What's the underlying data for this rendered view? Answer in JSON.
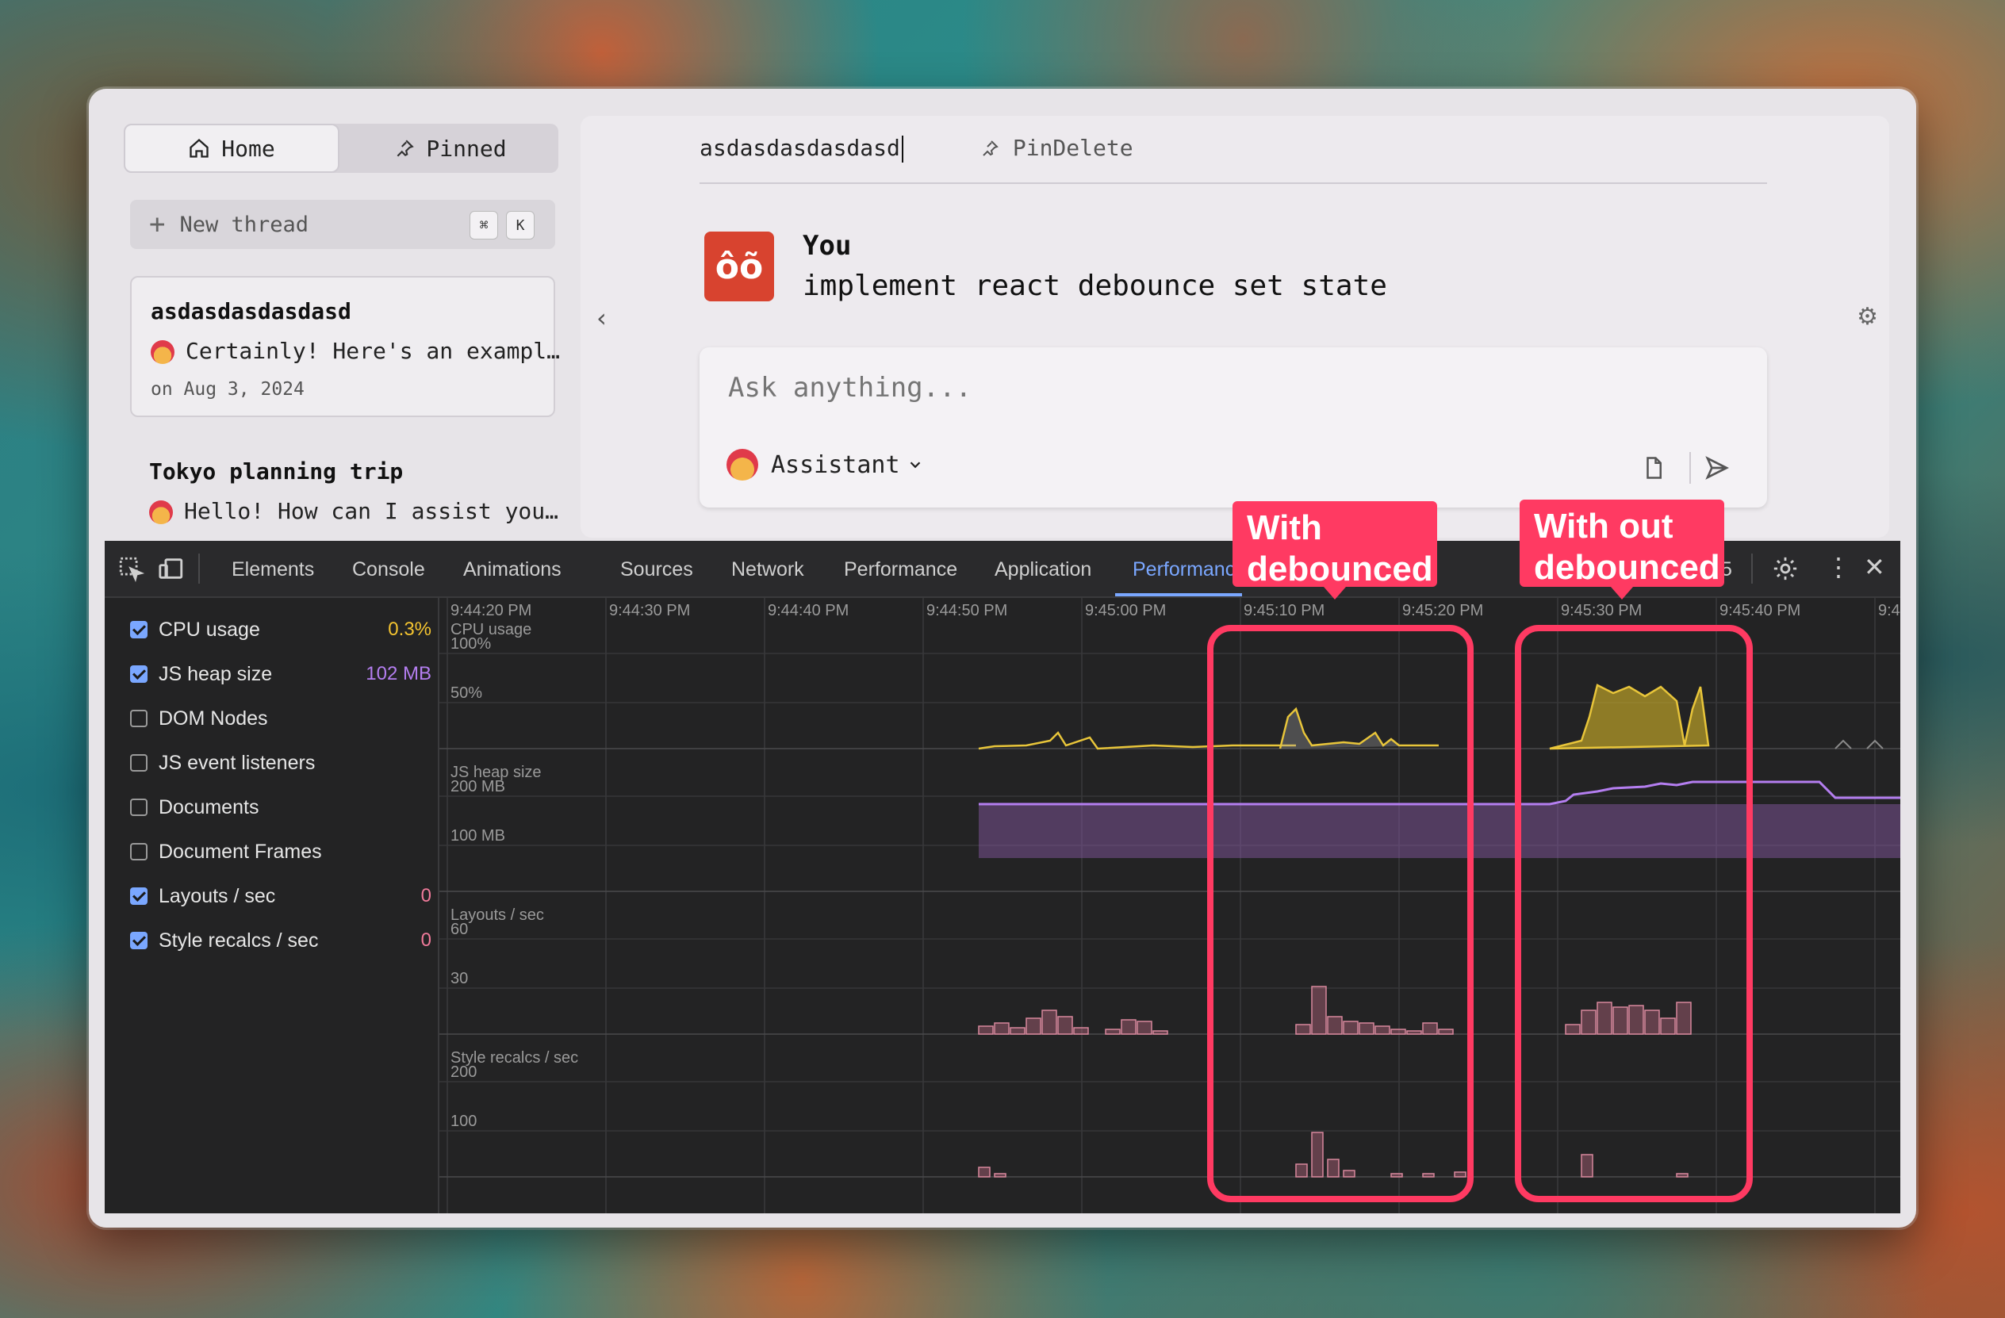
{
  "sidebar": {
    "home_label": "Home",
    "pinned_label": "Pinned",
    "new_thread_label": "New thread",
    "shortcut_keys": [
      "⌘",
      "K"
    ],
    "threads": [
      {
        "title": "asdasdasdasdasd",
        "snippet": "Certainly! Here's an exampl…",
        "date": "on Aug 3, 2024"
      },
      {
        "title": "Tokyo planning trip",
        "snippet": "Hello! How can I assist you…"
      }
    ]
  },
  "main": {
    "active_tab_title": "asdasdasdasdasd",
    "pin_delete_label": "PinDelete",
    "message": {
      "avatar_text": "ôõ",
      "author": "You",
      "text": "implement react debounce set state"
    },
    "composer": {
      "placeholder": "Ask anything...",
      "assistant_label": "Assistant"
    }
  },
  "devtools": {
    "tabs": [
      "Elements",
      "Console",
      "Animations",
      "Sources",
      "Network",
      "Performance",
      "Application",
      "Performance monitor"
    ],
    "overflow_count": "5",
    "metrics": [
      {
        "label": "CPU usage",
        "checked": true,
        "value": "0.3%",
        "color": "#f4c430"
      },
      {
        "label": "JS heap size",
        "checked": true,
        "value": "102 MB",
        "color": "#b47ef0"
      },
      {
        "label": "DOM Nodes",
        "checked": false,
        "value": ""
      },
      {
        "label": "JS event listeners",
        "checked": false,
        "value": ""
      },
      {
        "label": "Documents",
        "checked": false,
        "value": ""
      },
      {
        "label": "Document Frames",
        "checked": false,
        "value": ""
      },
      {
        "label": "Layouts / sec",
        "checked": true,
        "value": "0",
        "color": "#f07a9a"
      },
      {
        "label": "Style recalcs / sec",
        "checked": true,
        "value": "0",
        "color": "#f07a9a"
      }
    ],
    "time_labels": [
      "9:44:20 PM",
      "9:44:30 PM",
      "9:44:40 PM",
      "9:44:50 PM",
      "9:45:00 PM",
      "9:45:10 PM",
      "9:45:20 PM",
      "9:45:30 PM",
      "9:45:40 PM",
      "9:4"
    ],
    "panels": [
      {
        "title": "CPU usage",
        "ticks": [
          "100%",
          "50%"
        ]
      },
      {
        "title": "JS heap size",
        "ticks": [
          "200 MB",
          "100 MB"
        ]
      },
      {
        "title": "Layouts / sec",
        "ticks": [
          "60",
          "30"
        ]
      },
      {
        "title": "Style recalcs / sec",
        "ticks": [
          "200",
          "100"
        ]
      }
    ]
  },
  "annotations": {
    "left_label": "With debounced",
    "right_label": "With out debounced",
    "color": "#ff3a62"
  }
}
